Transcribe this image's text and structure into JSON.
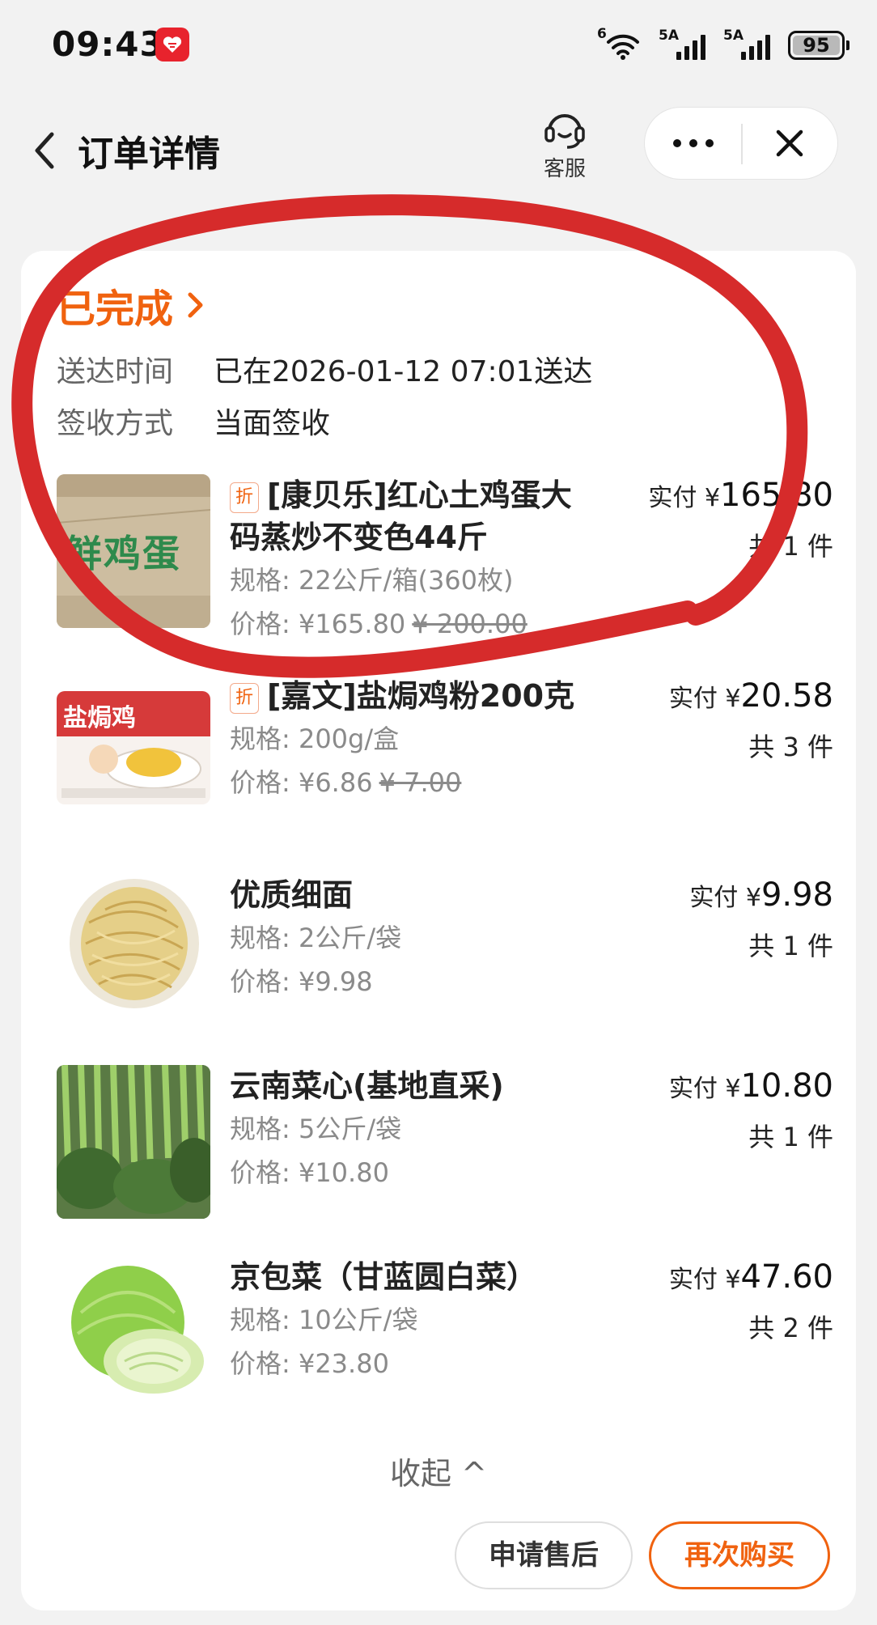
{
  "status_bar": {
    "time": "09:43",
    "wifi_label": "6",
    "signal_1_label": "5A",
    "signal_2_label": "5A",
    "battery": "95",
    "battery_level": 0.95
  },
  "nav": {
    "title": "订单详情",
    "customer_service_label": "客服"
  },
  "order": {
    "status": "已完成",
    "delivery_time_label": "送达时间",
    "delivery_time_value": "已在2026-01-12 07:01送达",
    "sign_method_label": "签收方式",
    "sign_method_value": "当面签收"
  },
  "items": [
    {
      "tag": "折",
      "name": "[康贝乐]红心土鸡蛋大码蒸炒不变色44斤",
      "spec": "规格: 22公斤/箱(360枚)",
      "price": "价格: ¥165.80",
      "original_price": "¥ 200.00",
      "paid_label": "实付 ¥",
      "paid_value": "165.80",
      "qty": "共 1 件",
      "thumb_text": "鲜鸡蛋"
    },
    {
      "tag": "折",
      "name": "[嘉文]盐焗鸡粉200克",
      "spec": "规格: 200g/盒",
      "price": "价格: ¥6.86",
      "original_price": "¥ 7.00",
      "paid_label": "实付 ¥",
      "paid_value": "20.58",
      "qty": "共 3 件",
      "thumb_text": "盐焗鸡"
    },
    {
      "name": "优质细面",
      "spec": "规格: 2公斤/袋",
      "price": "价格: ¥9.98",
      "paid_label": "实付 ¥",
      "paid_value": "9.98",
      "qty": "共 1 件"
    },
    {
      "name": "云南菜心(基地直采)",
      "spec": "规格: 5公斤/袋",
      "price": "价格: ¥10.80",
      "paid_label": "实付 ¥",
      "paid_value": "10.80",
      "qty": "共 1 件"
    },
    {
      "name": "京包菜（甘蓝圆白菜）",
      "spec": "规格: 10公斤/袋",
      "price": "价格: ¥23.80",
      "paid_label": "实付 ¥",
      "paid_value": "47.60",
      "qty": "共 2 件"
    }
  ],
  "collapse_label": "收起 ^",
  "buttons": {
    "after_sale": "申请售后",
    "rebuy": "再次购买"
  },
  "colors": {
    "accent": "#f0620f",
    "annotation": "#d62b2b",
    "background": "#f2f2f2"
  }
}
